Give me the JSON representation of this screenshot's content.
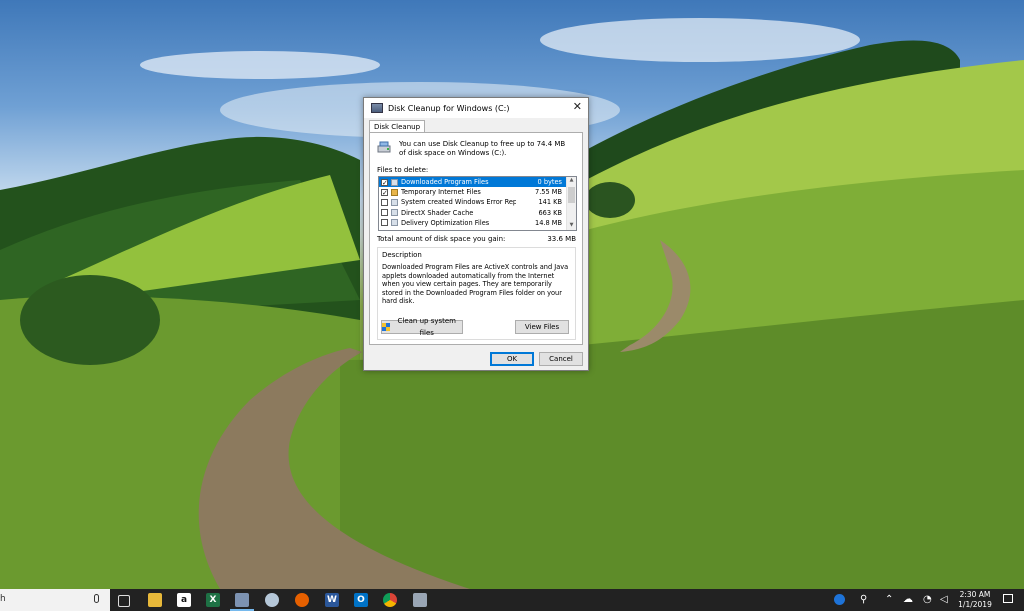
{
  "dialog": {
    "title": "Disk Cleanup for Windows (C:)",
    "close_glyph": "✕",
    "tab": "Disk Cleanup",
    "intro": "You can use Disk Cleanup to free up to 74.4 MB of disk space on Windows (C:).",
    "files_label": "Files to delete:",
    "files": [
      {
        "name": "Downloaded Program Files",
        "size": "0 bytes",
        "checked": true,
        "selected": true
      },
      {
        "name": "Temporary Internet Files",
        "size": "7.55 MB",
        "checked": true,
        "selected": false
      },
      {
        "name": "System created Windows Error Reporti...",
        "size": "141 KB",
        "checked": false,
        "selected": false
      },
      {
        "name": "DirectX Shader Cache",
        "size": "663 KB",
        "checked": false,
        "selected": false
      },
      {
        "name": "Delivery Optimization Files",
        "size": "14.8 MB",
        "checked": false,
        "selected": false
      }
    ],
    "total_label": "Total amount of disk space you gain:",
    "total_value": "33.6 MB",
    "description_label": "Description",
    "description": "Downloaded Program Files are ActiveX controls and Java applets downloaded automatically from the Internet when you view certain pages. They are temporarily stored in the Downloaded Program Files folder on your hard disk.",
    "cleanup_button": "Clean up system files",
    "view_files_button": "View Files",
    "ok_button": "OK",
    "cancel_button": "Cancel"
  },
  "taskbar": {
    "search_text": "h",
    "apps": [
      "task-view",
      "file-explorer",
      "amazon",
      "excel",
      "disk-cleanup",
      "snipping-tool",
      "firefox",
      "word",
      "outlook",
      "chrome",
      "disk-cleanup-pinned"
    ],
    "clock_time": "2:30 AM",
    "clock_date": "1/1/2019"
  },
  "colors": {
    "selection": "#0078d7",
    "taskbar": "#222222",
    "accent": "#76b9ed"
  }
}
